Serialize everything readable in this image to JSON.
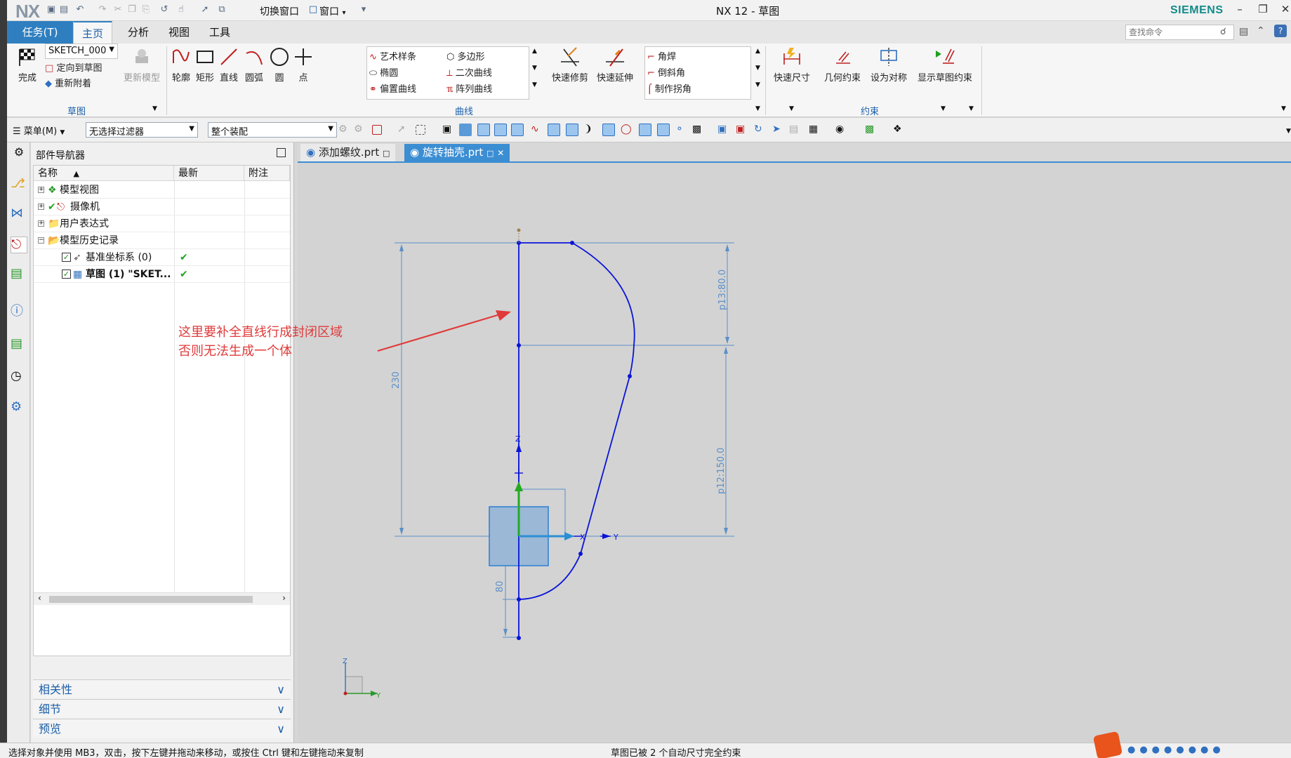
{
  "app": {
    "logo": "NX",
    "title": "NX 12 - 草图",
    "brand": "SIEMENS"
  },
  "quickbar": {
    "switch_window": "切换窗口",
    "window": "窗口"
  },
  "menu_tabs": {
    "task": "任务(T)",
    "home": "主页",
    "analysis": "分析",
    "view": "视图",
    "tools": "工具"
  },
  "search": {
    "placeholder": "查找命令"
  },
  "ribbon": {
    "sketch_group": {
      "finish": "完成",
      "sketch_name": "SKETCH_000",
      "orient": "定向到草图",
      "reattach": "重新附着",
      "update_model": "更新模型",
      "label": "草图"
    },
    "curve_group": {
      "profile": "轮廓",
      "rectangle": "矩形",
      "line": "直线",
      "arc": "圆弧",
      "circle": "圆",
      "point": "点",
      "studio_spline": "艺术样条",
      "ellipse": "椭圆",
      "offset_curve": "偏置曲线",
      "polygon": "多边形",
      "conic": "二次曲线",
      "pattern_curve": "阵列曲线",
      "quick_trim": "快速修剪",
      "quick_extend": "快速延伸",
      "fillet": "角焊",
      "chamfer": "倒斜角",
      "make_corner": "制作拐角",
      "label": "曲线"
    },
    "constraint_group": {
      "rapid_dimension": "快速尺寸",
      "geometric_constraints": "几何约束",
      "make_symmetric": "设为对称",
      "show_constraints": "显示草图约束",
      "label": "约束"
    }
  },
  "selection_bar": {
    "menu": "菜单(M)",
    "filter": "无选择过滤器",
    "scope": "整个装配"
  },
  "navigator": {
    "title": "部件导航器",
    "columns": [
      "名称",
      "最新",
      "附注"
    ],
    "rows": [
      {
        "label": "模型视图"
      },
      {
        "label": "摄像机"
      },
      {
        "label": "用户表达式"
      },
      {
        "label": "模型历史记录"
      },
      {
        "label": "基准坐标系 (0)"
      },
      {
        "label": "草图 (1) \"SKET..."
      }
    ],
    "panels": [
      "相关性",
      "细节",
      "预览"
    ]
  },
  "doc_tabs": [
    "添加螺纹.prt",
    "旋转抽壳.prt"
  ],
  "canvas": {
    "annotation_line1": "这里要补全直线行成封闭区域",
    "annotation_line2": "否则无法生成一个体",
    "dim_total": "230",
    "dim_upper": "p13:80.0",
    "dim_lower": "p12:150.0",
    "dim_bottom": "80",
    "axis_x": "X",
    "axis_y": "Y",
    "axis_z": "Z",
    "triad_z": "Z",
    "triad_y": "Y"
  },
  "status": {
    "left": "选择对象并使用 MB3，双击，按下左键并拖动来移动，或按住 Ctrl 键和左键拖动来复制",
    "middle": "草图已被 2 个自动尺寸完全约束"
  },
  "colors": {
    "accent": "#2f7fc0",
    "sketch_curve": "#0a14d8",
    "dimension": "#5b8fc8",
    "annotation": "#e03a3a"
  }
}
